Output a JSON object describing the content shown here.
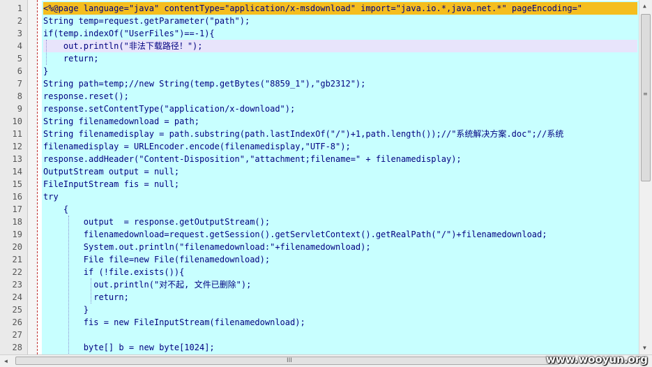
{
  "editor": {
    "line_numbers": [
      "1",
      "2",
      "3",
      "4",
      "5",
      "6",
      "7",
      "8",
      "9",
      "10",
      "11",
      "12",
      "13",
      "14",
      "15",
      "16",
      "17",
      "18",
      "19",
      "20",
      "21",
      "22",
      "23",
      "24",
      "25",
      "26",
      "27",
      "28"
    ],
    "lines": [
      "<%@page language=\"java\" contentType=\"application/x-msdownload\" import=\"java.io.*,java.net.*\" pageEncoding=\"",
      "String temp=request.getParameter(\"path\");",
      "if(temp.indexOf(\"UserFiles\")==-1){",
      "    out.println(\"非法下载路径！\");",
      "    return;",
      "}",
      "String path=temp;//new String(temp.getBytes(\"8859_1\"),\"gb2312\");",
      "response.reset();",
      "response.setContentType(\"application/x-download\");",
      "String filenamedownload = path;",
      "String filenamedisplay = path.substring(path.lastIndexOf(\"/\")+1,path.length());//\"系统解决方案.doc\";//系统",
      "filenamedisplay = URLEncoder.encode(filenamedisplay,\"UTF-8\");",
      "response.addHeader(\"Content-Disposition\",\"attachment;filename=\" + filenamedisplay);",
      "OutputStream output = null;",
      "FileInputStream fis = null;",
      "try",
      "    {",
      "        output  = response.getOutputStream();",
      "        filenamedownload=request.getSession().getServletContext().getRealPath(\"/\")+filenamedownload;",
      "        System.out.println(\"filenamedownload:\"+filenamedownload);",
      "        File file=new File(filenamedownload);",
      "        if (!file.exists()){",
      "          out.println(\"对不起, 文件已删除\");",
      "          return;",
      "        }",
      "        fis = new FileInputStream(filenamedownload);",
      "",
      "        byte[] b = new byte[1024];"
    ]
  },
  "scrollbar": {
    "up_arrow": "▲",
    "down_arrow": "▼",
    "left_arrow": "◀",
    "right_arrow": "▶",
    "grip": "III"
  },
  "watermark": "www.wooyun.org"
}
